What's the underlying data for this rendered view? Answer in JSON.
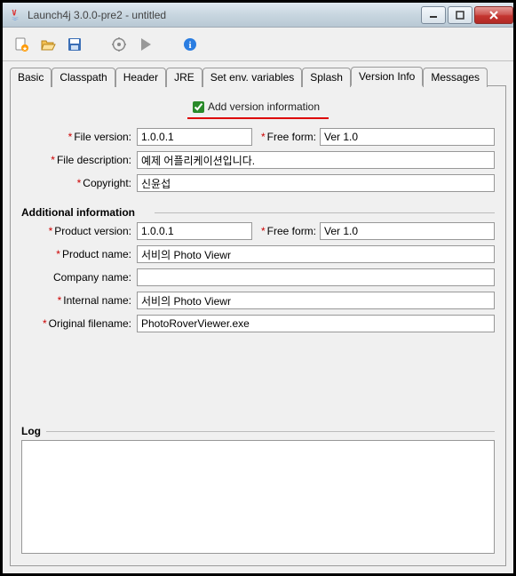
{
  "window": {
    "title": "Launch4j 3.0.0-pre2 - untitled"
  },
  "tabs": {
    "basic": "Basic",
    "classpath": "Classpath",
    "header": "Header",
    "jre": "JRE",
    "setenv": "Set env. variables",
    "splash": "Splash",
    "version": "Version Info",
    "messages": "Messages"
  },
  "version": {
    "checkbox_label": "Add version information",
    "checkbox_checked": true,
    "file_version_label": "File version:",
    "file_version": "1.0.0.1",
    "free_form_label": "Free form:",
    "free_form1": "Ver 1.0",
    "file_desc_label": "File description:",
    "file_desc": "예제 어플리케이션입니다.",
    "copyright_label": "Copyright:",
    "copyright": "신윤섭"
  },
  "additional": {
    "section": "Additional information",
    "product_version_label": "Product version:",
    "product_version": "1.0.0.1",
    "free_form_label": "Free form:",
    "free_form2": "Ver 1.0",
    "product_name_label": "Product name:",
    "product_name": "서비의 Photo Viewr",
    "company_label": "Company name:",
    "company": "",
    "internal_label": "Internal name:",
    "internal": "서비의 Photo Viewr",
    "orig_file_label": "Original filename:",
    "orig_file": "PhotoRoverViewer.exe"
  },
  "log": {
    "title": "Log",
    "content": ""
  }
}
